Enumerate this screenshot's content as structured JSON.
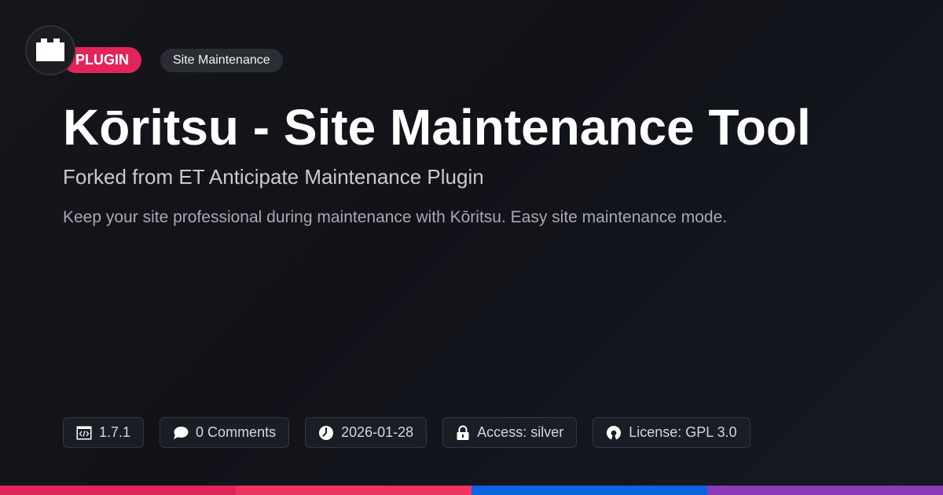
{
  "badge": {
    "type": "PLUGIN",
    "category": "Site Maintenance"
  },
  "title": "Kōritsu - Site Maintenance Tool",
  "subtitle": "Forked from ET Anticipate Maintenance Plugin",
  "description": "Keep your site professional during maintenance with Kōritsu. Easy site maintenance mode.",
  "meta": {
    "version": "1.7.1",
    "comments": "0 Comments",
    "date": "2026-01-28",
    "access": "Access: silver",
    "license": "License: GPL 3.0"
  },
  "icons": {
    "logo": "brick-logo-icon",
    "version": "code-window-icon",
    "comments": "speech-bubble-icon",
    "date": "clock-icon",
    "access": "lock-icon",
    "license": "open-source-icon"
  },
  "colors": {
    "accent": "#e3245a",
    "bar": [
      "#e3245a",
      "#f2335f",
      "#0a63e0",
      "#8a3ab5"
    ]
  }
}
